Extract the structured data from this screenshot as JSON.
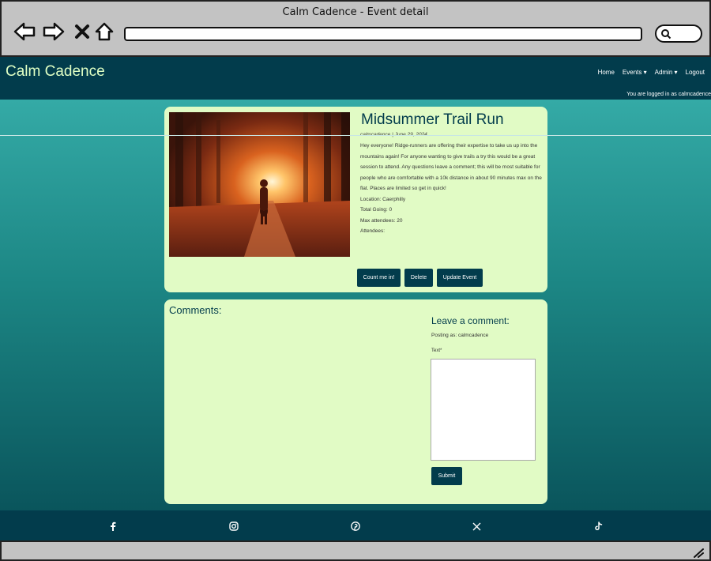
{
  "window": {
    "title": "Calm Cadence - Event detail"
  },
  "nav": {
    "brand": "Calm Cadence",
    "links": [
      "Home",
      "Events ▾",
      "Admin ▾",
      "Logout"
    ],
    "logged_in": "You are logged in as calmcadence"
  },
  "event": {
    "title": "Midsummer Trail Run",
    "meta": "calmcadence | June 29, 2024",
    "description": "Hey everyone! Ridge-runners are offering their expertise to take us up into the mountains again! For anyone wanting to give trails a try this would be a great session to attend. Any questions leave a comment; this will be most suitable for people who are comfortable with a 10k distance in about 90 minutes max on the flat. Places are limited so get in quick!",
    "location": "Location: Caerphilly",
    "total_going": "Total Going: 0",
    "max_attendees": "Max attendees: 20",
    "attendees": "Attendees:",
    "buttons": {
      "count_me_in": "Count me in!",
      "delete": "Delete",
      "update": "Update Event"
    }
  },
  "comments": {
    "heading": "Comments:",
    "leave_heading": "Leave a comment:",
    "posting_as": "Posting as: calmcadence",
    "text_label": "Text*",
    "text_value": "",
    "submit": "Submit"
  },
  "footer": {
    "icons": [
      "facebook-icon",
      "instagram-icon",
      "pinterest-icon",
      "x-icon",
      "tiktok-icon"
    ]
  },
  "colors": {
    "nav": "#023c4c",
    "card": "#e1fbc5",
    "brand": "#dfffc4",
    "teal_top": "#34aaa6",
    "teal_bottom": "#0a555c"
  }
}
